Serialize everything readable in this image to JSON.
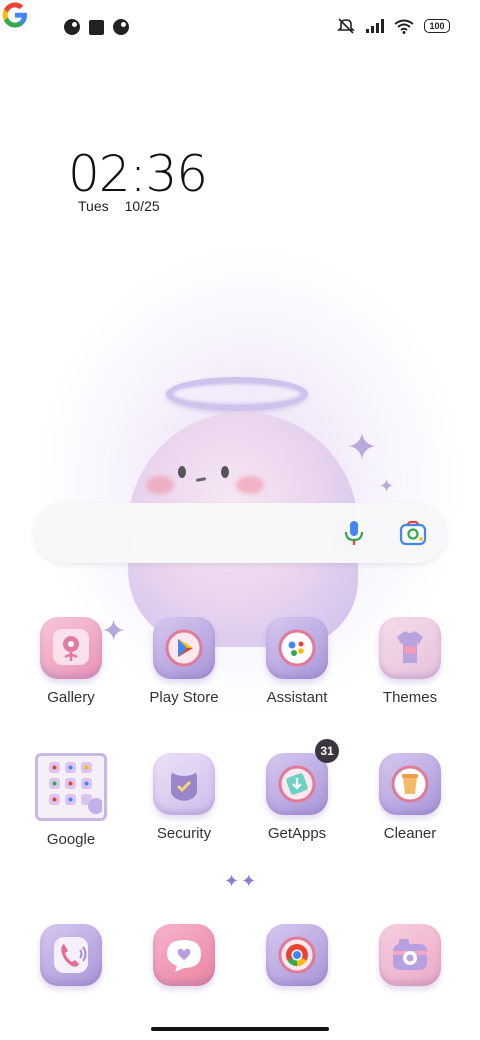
{
  "status_bar": {
    "left_icons": [
      "notification-icon",
      "square-notification-icon",
      "notification-icon"
    ],
    "right_icons": [
      "mute-icon",
      "cellular-signal-icon",
      "wifi-icon",
      "battery-icon"
    ],
    "battery_level": "100"
  },
  "clock": {
    "time": "02:36",
    "day": "Tues",
    "date": "10/25"
  },
  "search_bar": {
    "logo": "google-g-icon",
    "mic": "microphone-icon",
    "lens": "google-lens-icon"
  },
  "apps": [
    {
      "label": "Gallery",
      "icon": "gallery-icon"
    },
    {
      "label": "Play Store",
      "icon": "play-store-icon"
    },
    {
      "label": "Assistant",
      "icon": "assistant-icon"
    },
    {
      "label": "Themes",
      "icon": "themes-icon"
    },
    {
      "label": "Google",
      "icon": "google-folder-icon"
    },
    {
      "label": "Security",
      "icon": "security-icon"
    },
    {
      "label": "GetApps",
      "icon": "getapps-icon",
      "badge": "31"
    },
    {
      "label": "Cleaner",
      "icon": "cleaner-icon"
    }
  ],
  "dock": [
    {
      "icon": "phone-icon"
    },
    {
      "icon": "messages-icon"
    },
    {
      "icon": "chrome-icon"
    },
    {
      "icon": "camera-icon"
    }
  ],
  "colors": {
    "accent": "#b9a3e3",
    "pink": "#f3a8c6",
    "badge": "#3b3540"
  }
}
